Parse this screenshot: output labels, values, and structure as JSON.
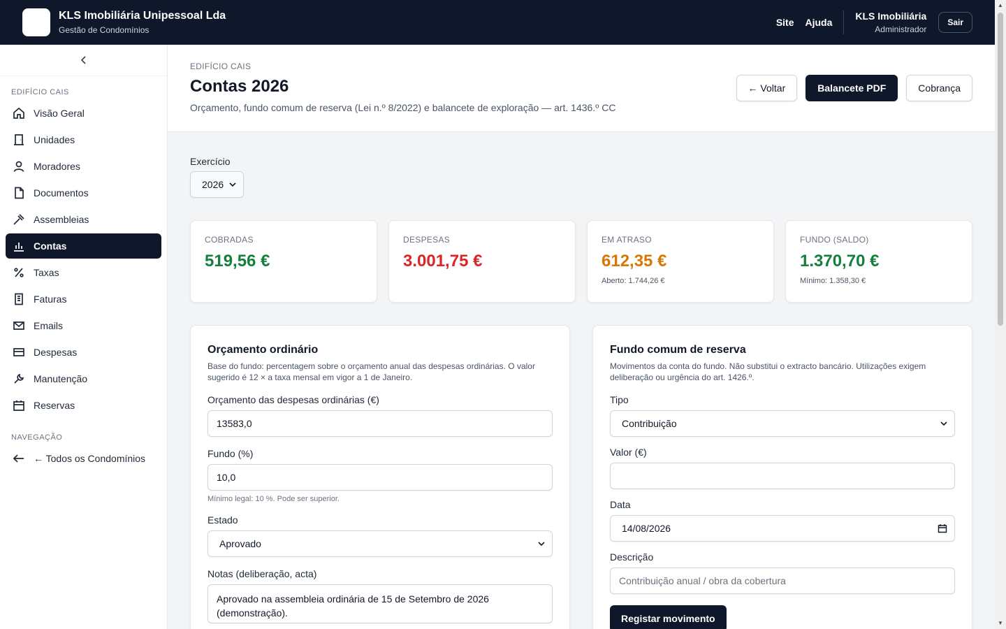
{
  "topbar": {
    "brand_name": "KLS Imobiliária Unipessoal Lda",
    "brand_sub": "Gestão de Condomínios",
    "links": [
      "Site",
      "Ajuda"
    ],
    "user_name": "KLS Imobiliária",
    "user_role": "Administrador",
    "logout_label": "Sair"
  },
  "sidebar": {
    "section_building": "EDIFÍCIO CAIS",
    "items": [
      {
        "label": "Visão Geral",
        "icon": "home-icon"
      },
      {
        "label": "Unidades",
        "icon": "door-icon"
      },
      {
        "label": "Moradores",
        "icon": "user-icon"
      },
      {
        "label": "Documentos",
        "icon": "file-icon"
      },
      {
        "label": "Assembleias",
        "icon": "gavel-icon"
      },
      {
        "label": "Contas",
        "icon": "bar-chart-icon",
        "active": true
      },
      {
        "label": "Taxas",
        "icon": "percent-icon"
      },
      {
        "label": "Faturas",
        "icon": "receipt-icon"
      },
      {
        "label": "Emails",
        "icon": "mail-icon"
      },
      {
        "label": "Despesas",
        "icon": "credit-card-icon"
      },
      {
        "label": "Manutenção",
        "icon": "wrench-icon"
      },
      {
        "label": "Reservas",
        "icon": "calendar-icon"
      }
    ],
    "section_nav": "NAVEGAÇÃO",
    "nav_back": "← Todos os Condomínios"
  },
  "header": {
    "crumb": "EDIFÍCIO CAIS",
    "title": "Contas 2026",
    "subtitle": "Orçamento, fundo comum de reserva (Lei n.º 8/2022) e balancete de exploração — art. 1436.º CC",
    "actions": {
      "back": "← Voltar",
      "pdf": "Balancete PDF",
      "billing": "Cobrança"
    }
  },
  "exercise": {
    "label": "Exercício",
    "value": "2026"
  },
  "stats": [
    {
      "label": "COBRADAS",
      "value": "519,56 €",
      "color": "#15803d",
      "foot": ""
    },
    {
      "label": "DESPESAS",
      "value": "3.001,75 €",
      "color": "#dc2626",
      "foot": ""
    },
    {
      "label": "EM ATRASO",
      "value": "612,35 €",
      "color": "#d97706",
      "foot": "Aberto: 1.744,26 €"
    },
    {
      "label": "FUNDO (SALDO)",
      "value": "1.370,70 €",
      "color": "#15803d",
      "foot": "Mínimo: 1.358,30 €"
    }
  ],
  "budget": {
    "title": "Orçamento ordinário",
    "desc": "Base do fundo: percentagem sobre o orçamento anual das despesas ordinárias. O valor sugerido é 12 × a taxa mensal em vigor a 1 de Janeiro.",
    "budget_label": "Orçamento das despesas ordinárias (€)",
    "budget_value": "13583,0",
    "fund_label": "Fundo (%)",
    "fund_value": "10,0",
    "fund_help": "Mínimo legal: 10 %. Pode ser superior.",
    "state_label": "Estado",
    "state_value": "Aprovado",
    "notes_label": "Notas (deliberação, acta)",
    "notes_value": "Aprovado na assembleia ordinária de 15 de Setembro de 2026 (demonstração)."
  },
  "reserve": {
    "title": "Fundo comum de reserva",
    "desc": "Movimentos da conta do fundo. Não substitui o extracto bancário. Utilizações exigem deliberação ou urgência do art. 1426.º.",
    "type_label": "Tipo",
    "type_value": "Contribuição",
    "value_label": "Valor (€)",
    "value_value": "",
    "date_label": "Data",
    "date_value": "14/08/2026",
    "desc_label": "Descrição",
    "desc_placeholder": "Contribuição anual / obra da cobertura",
    "submit": "Registar movimento"
  }
}
